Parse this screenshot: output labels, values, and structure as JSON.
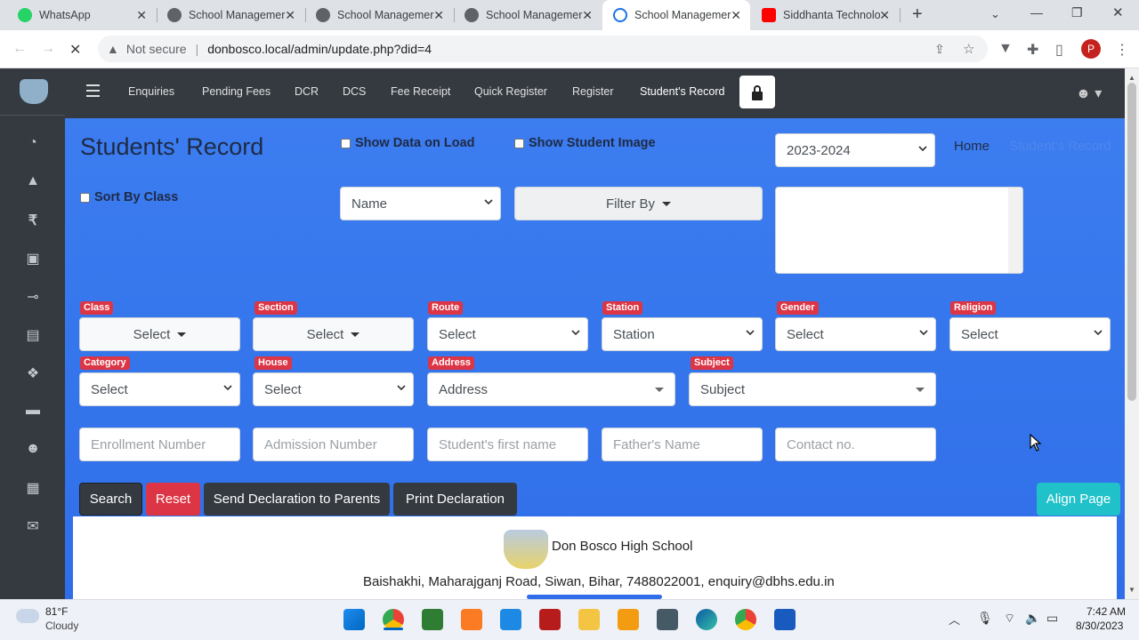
{
  "browser": {
    "tabs": [
      {
        "title": "WhatsApp",
        "icon": "whatsapp-icon"
      },
      {
        "title": "School Managemer",
        "icon": "globe-icon"
      },
      {
        "title": "School Managemer",
        "icon": "globe-icon"
      },
      {
        "title": "School Managemer",
        "icon": "globe-icon"
      },
      {
        "title": "School Managemer",
        "icon": "loading-icon"
      },
      {
        "title": "Siddhanta Technolo",
        "icon": "youtube-icon"
      }
    ],
    "security": "Not secure",
    "url": "donbosco.local/admin/update.php?did=4",
    "profile_initial": "P"
  },
  "nav": [
    "Enquiries",
    "Pending Fees",
    "DCR",
    "DCS",
    "Fee Receipt",
    "Quick Register",
    "Register",
    "Student's Record"
  ],
  "page": {
    "title": "Students' Record",
    "show_data_on_load": "Show Data on Load",
    "show_student_image": "Show Student Image",
    "sort_by_class": "Sort By Class",
    "session": "2023-2024",
    "breadcrumb_home": "Home",
    "breadcrumb_current": "Student's Record",
    "name_select": "Name",
    "filter_by": "Filter By"
  },
  "filters": {
    "class": {
      "label": "Class",
      "value": "Select"
    },
    "section": {
      "label": "Section",
      "value": "Select"
    },
    "route": {
      "label": "Route",
      "value": "Select"
    },
    "station": {
      "label": "Station",
      "value": "Station"
    },
    "gender": {
      "label": "Gender",
      "value": "Select"
    },
    "religion": {
      "label": "Religion",
      "value": "Select"
    },
    "category": {
      "label": "Category",
      "value": "Select"
    },
    "house": {
      "label": "House",
      "value": "Select"
    },
    "address": {
      "label": "Address",
      "value": "Address"
    },
    "subject": {
      "label": "Subject",
      "value": "Subject"
    }
  },
  "inputs": {
    "enrollment": "Enrollment Number",
    "admission": "Admission Number",
    "first_name": "Student's first name",
    "father": "Father's Name",
    "contact": "Contact no."
  },
  "buttons": {
    "search": "Search",
    "reset": "Reset",
    "send_declaration": "Send Declaration to Parents",
    "print_declaration": "Print Declaration",
    "align_page": "Align Page"
  },
  "school": {
    "name": "Don Bosco High School",
    "address": "Baishakhi, Maharajganj Road, Siwan, Bihar, 7488022001, enquiry@dbhs.edu.in"
  },
  "taskbar": {
    "temp": "81°F",
    "weather": "Cloudy",
    "time": "7:42 AM",
    "date": "8/30/2023"
  },
  "colors": {
    "accent": "#3c7df0",
    "dark": "#343a40",
    "danger": "#dc3545",
    "teal": "#20c1c9"
  }
}
